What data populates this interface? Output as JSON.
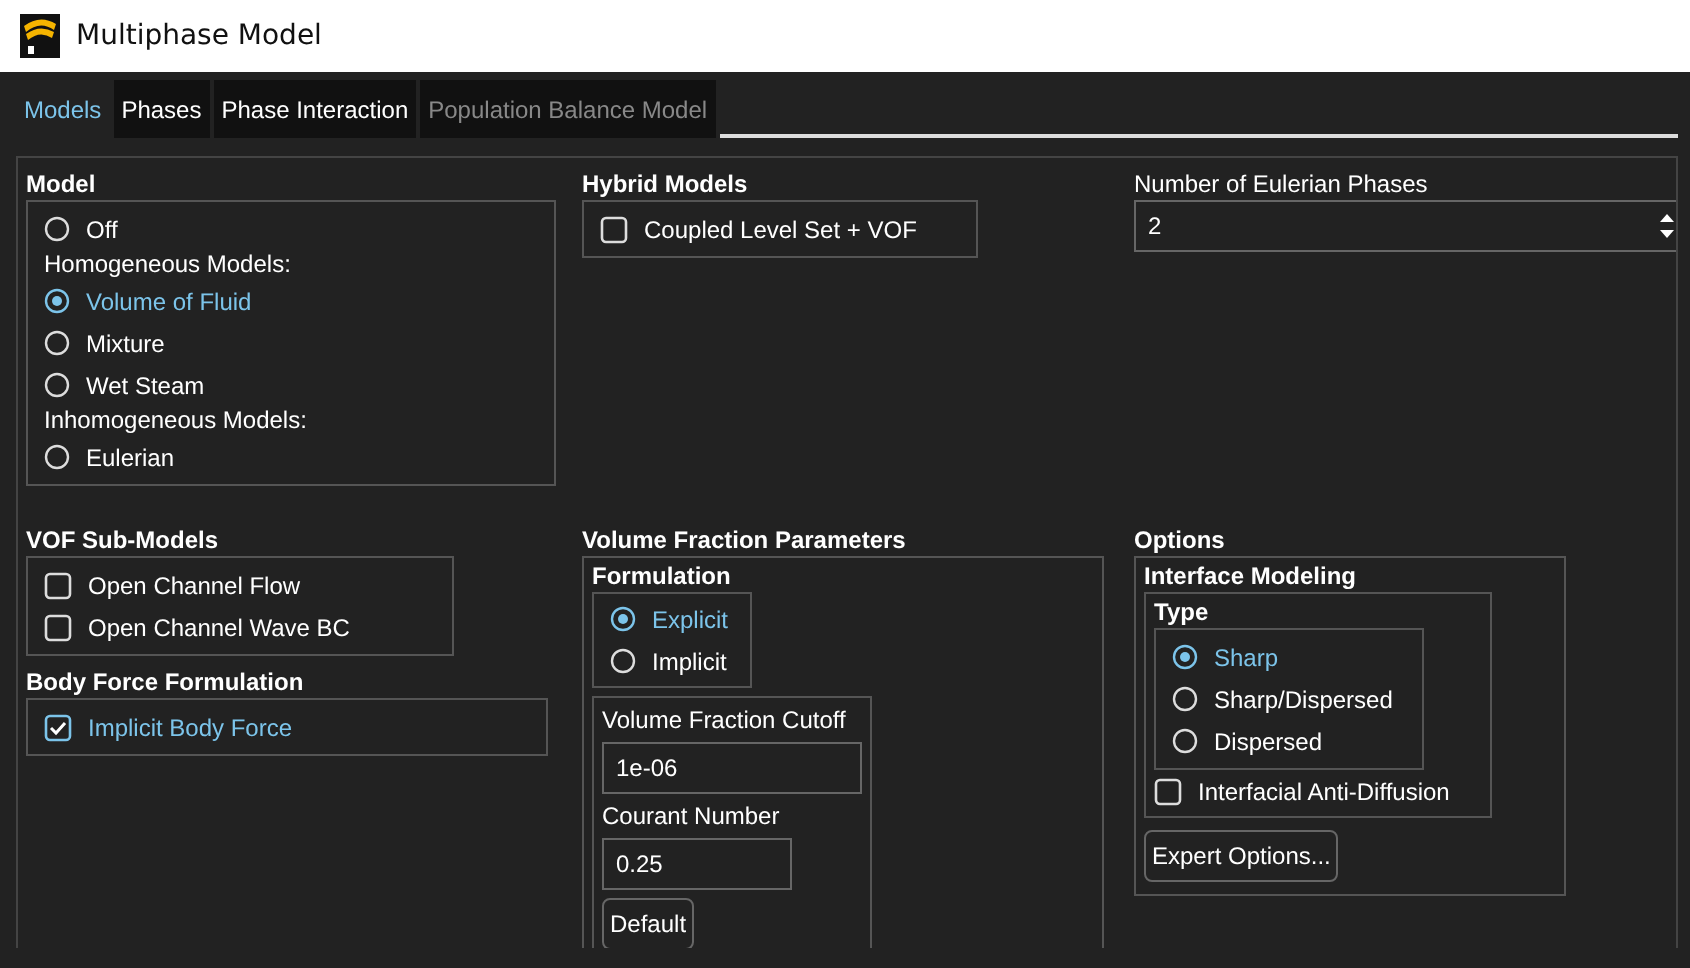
{
  "window": {
    "title": "Multiphase Model"
  },
  "tabs": [
    {
      "label": "Models",
      "selected": true,
      "disabled": false
    },
    {
      "label": "Phases",
      "selected": false,
      "disabled": false
    },
    {
      "label": "Phase Interaction",
      "selected": false,
      "disabled": false
    },
    {
      "label": "Population Balance Model",
      "selected": false,
      "disabled": true
    }
  ],
  "model": {
    "title": "Model",
    "items": [
      {
        "kind": "radio",
        "label": "Off",
        "selected": false
      },
      {
        "kind": "heading",
        "label": "Homogeneous Models:"
      },
      {
        "kind": "radio",
        "label": "Volume of Fluid",
        "selected": true
      },
      {
        "kind": "radio",
        "label": "Mixture",
        "selected": false
      },
      {
        "kind": "radio",
        "label": "Wet Steam",
        "selected": false
      },
      {
        "kind": "heading",
        "label": "Inhomogeneous Models:"
      },
      {
        "kind": "radio",
        "label": "Eulerian",
        "selected": false
      }
    ]
  },
  "hybrid_models": {
    "title": "Hybrid Models",
    "options": [
      {
        "label": "Coupled Level Set + VOF",
        "checked": false
      }
    ]
  },
  "eulerian_phases": {
    "label": "Number of Eulerian Phases",
    "value": "2"
  },
  "vof_sub_models": {
    "title": "VOF Sub-Models",
    "options": [
      {
        "label": "Open Channel Flow",
        "checked": false
      },
      {
        "label": "Open Channel Wave BC",
        "checked": false
      }
    ]
  },
  "body_force": {
    "title": "Body Force Formulation",
    "options": [
      {
        "label": "Implicit Body Force",
        "checked": true
      }
    ]
  },
  "volume_fraction_parameters": {
    "title": "Volume Fraction Parameters",
    "formulation": {
      "title": "Formulation",
      "options": [
        {
          "label": "Explicit",
          "selected": true
        },
        {
          "label": "Implicit",
          "selected": false
        }
      ]
    },
    "fields": [
      {
        "label": "Volume Fraction Cutoff",
        "value": "1e-06"
      },
      {
        "label": "Courant Number",
        "value": "0.25"
      }
    ],
    "default_button": "Default"
  },
  "options": {
    "title": "Options",
    "interface_modeling": {
      "title": "Interface Modeling",
      "type": {
        "title": "Type",
        "options": [
          {
            "label": "Sharp",
            "selected": true
          },
          {
            "label": "Sharp/Dispersed",
            "selected": false
          },
          {
            "label": "Dispersed",
            "selected": false
          }
        ]
      },
      "anti_diffusion": {
        "label": "Interfacial Anti-Diffusion",
        "checked": false
      }
    },
    "expert_button": "Expert Options..."
  }
}
